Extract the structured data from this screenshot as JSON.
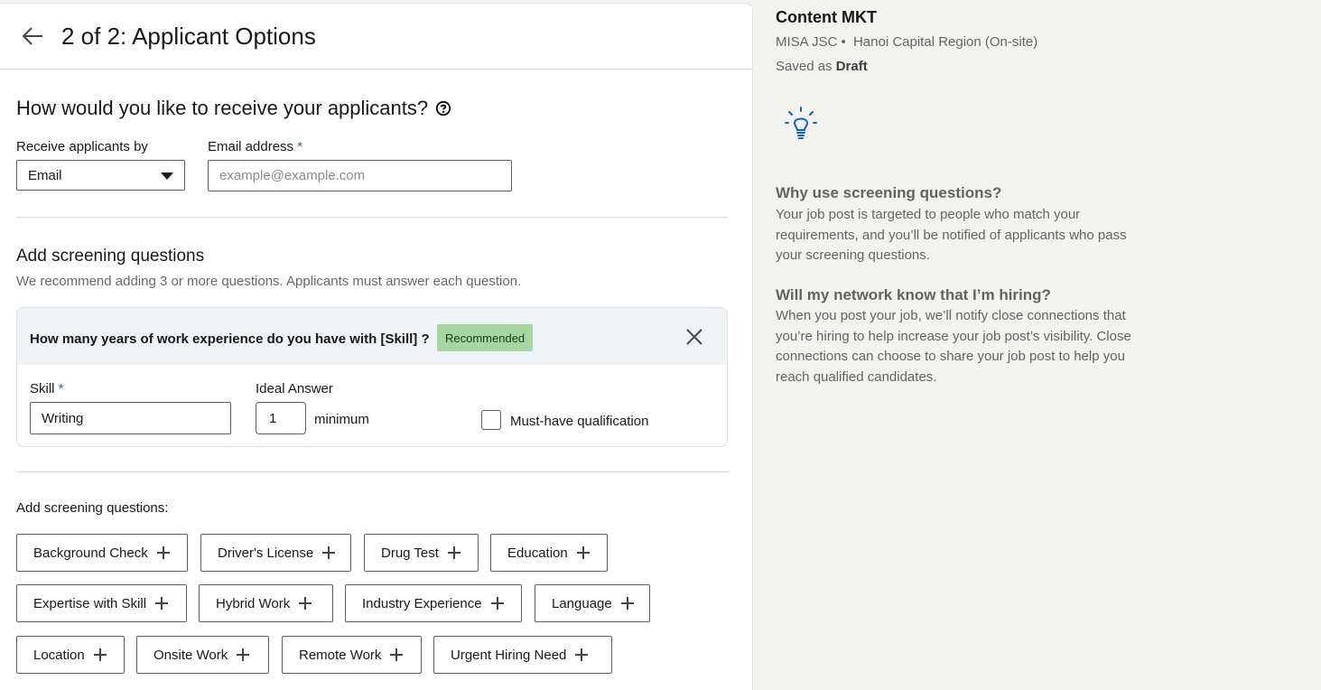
{
  "header": {
    "title": "2 of 2: Applicant Options"
  },
  "receive": {
    "question": "How would you like to receive your applicants?",
    "method_label": "Receive applicants by",
    "method_value": "Email",
    "email_label": "Email address",
    "required_mark": "*",
    "email_placeholder": "example@example.com"
  },
  "screening": {
    "title": "Add screening questions",
    "subtitle": "We recommend adding 3 or more questions. Applicants must answer each question.",
    "question_card": {
      "question": "How many years of work experience do you have with [Skill] ?",
      "badge": "Recommended",
      "skill_label": "Skill",
      "skill_value": "Writing",
      "ideal_label": "Ideal Answer",
      "ideal_value": "1",
      "minimum_label": "minimum",
      "must_have_label": "Must-have qualification",
      "must_have_checked": false
    },
    "add_label": "Add screening questions:",
    "chips": [
      "Background Check",
      "Driver's License",
      "Drug Test",
      "Education",
      "Expertise with Skill",
      "Hybrid Work",
      "Industry Experience",
      "Language",
      "Location",
      "Onsite Work",
      "Remote Work",
      "Urgent Hiring Need"
    ]
  },
  "job": {
    "title": "Content MKT",
    "company": "MISA JSC",
    "separator": "•",
    "location": "Hanoi Capital Region (On-site)",
    "saved_prefix": "Saved as",
    "saved_status": "Draft"
  },
  "faq": [
    {
      "question": "Why use screening questions?",
      "answer": "Your job post is targeted to people who match your requirements, and you’ll be notified of applicants who pass your screening questions."
    },
    {
      "question": "Will my network know that I’m hiring?",
      "answer": "When you post your job, we’ll notify close connections that you’re hiring to help increase your job post’s visibility. Close connections can choose to share your job post to help you reach qualified candidates."
    }
  ],
  "colors": {
    "page_bg": "#f3f2ef",
    "card_head_bg": "#eef3f8",
    "badge_bg": "#a7d7a0",
    "required": "#2b6c94",
    "bulb": "#0a66c2"
  },
  "icons": {
    "back": "arrow-left-icon",
    "help": "question-circle-icon",
    "caret": "caret-down-icon",
    "close": "close-icon",
    "plus": "plus-icon",
    "bulb": "lightbulb-icon"
  }
}
